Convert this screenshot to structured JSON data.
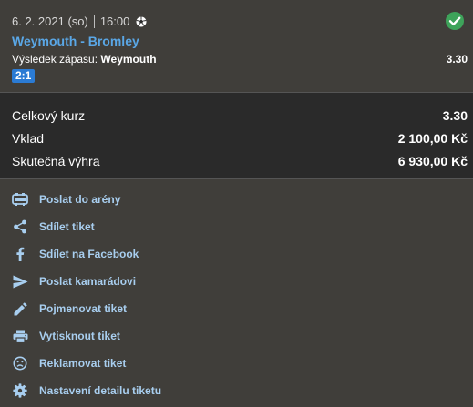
{
  "match": {
    "date": "6. 2. 2021 (so)",
    "time": "16:00",
    "teams": "Weymouth - Bromley",
    "result_label": "Výsledek zápasu:",
    "result_value": "Weymouth",
    "odd": "3.30",
    "score": "2:1",
    "status": "won",
    "colors": {
      "accent": "#5aa7e6",
      "won": "#3ea35a",
      "score_bg": "#2b7bd4"
    }
  },
  "summary": {
    "total_odds_label": "Celkový kurz",
    "total_odds_value": "3.30",
    "stake_label": "Vklad",
    "stake_value": "2 100,00 Kč",
    "win_label": "Skutečná výhra",
    "win_value": "6 930,00 Kč"
  },
  "actions": [
    {
      "label": "Poslat do arény",
      "icon": "arena-icon"
    },
    {
      "label": "Sdílet tiket",
      "icon": "share-icon"
    },
    {
      "label": "Sdílet na Facebook",
      "icon": "facebook-icon"
    },
    {
      "label": "Poslat kamarádovi",
      "icon": "send-icon"
    },
    {
      "label": "Pojmenovat tiket",
      "icon": "pencil-icon"
    },
    {
      "label": "Vytisknout tiket",
      "icon": "print-icon"
    },
    {
      "label": "Reklamovat tiket",
      "icon": "sad-face-icon"
    },
    {
      "label": "Nastavení detailu tiketu",
      "icon": "gear-icon"
    }
  ]
}
